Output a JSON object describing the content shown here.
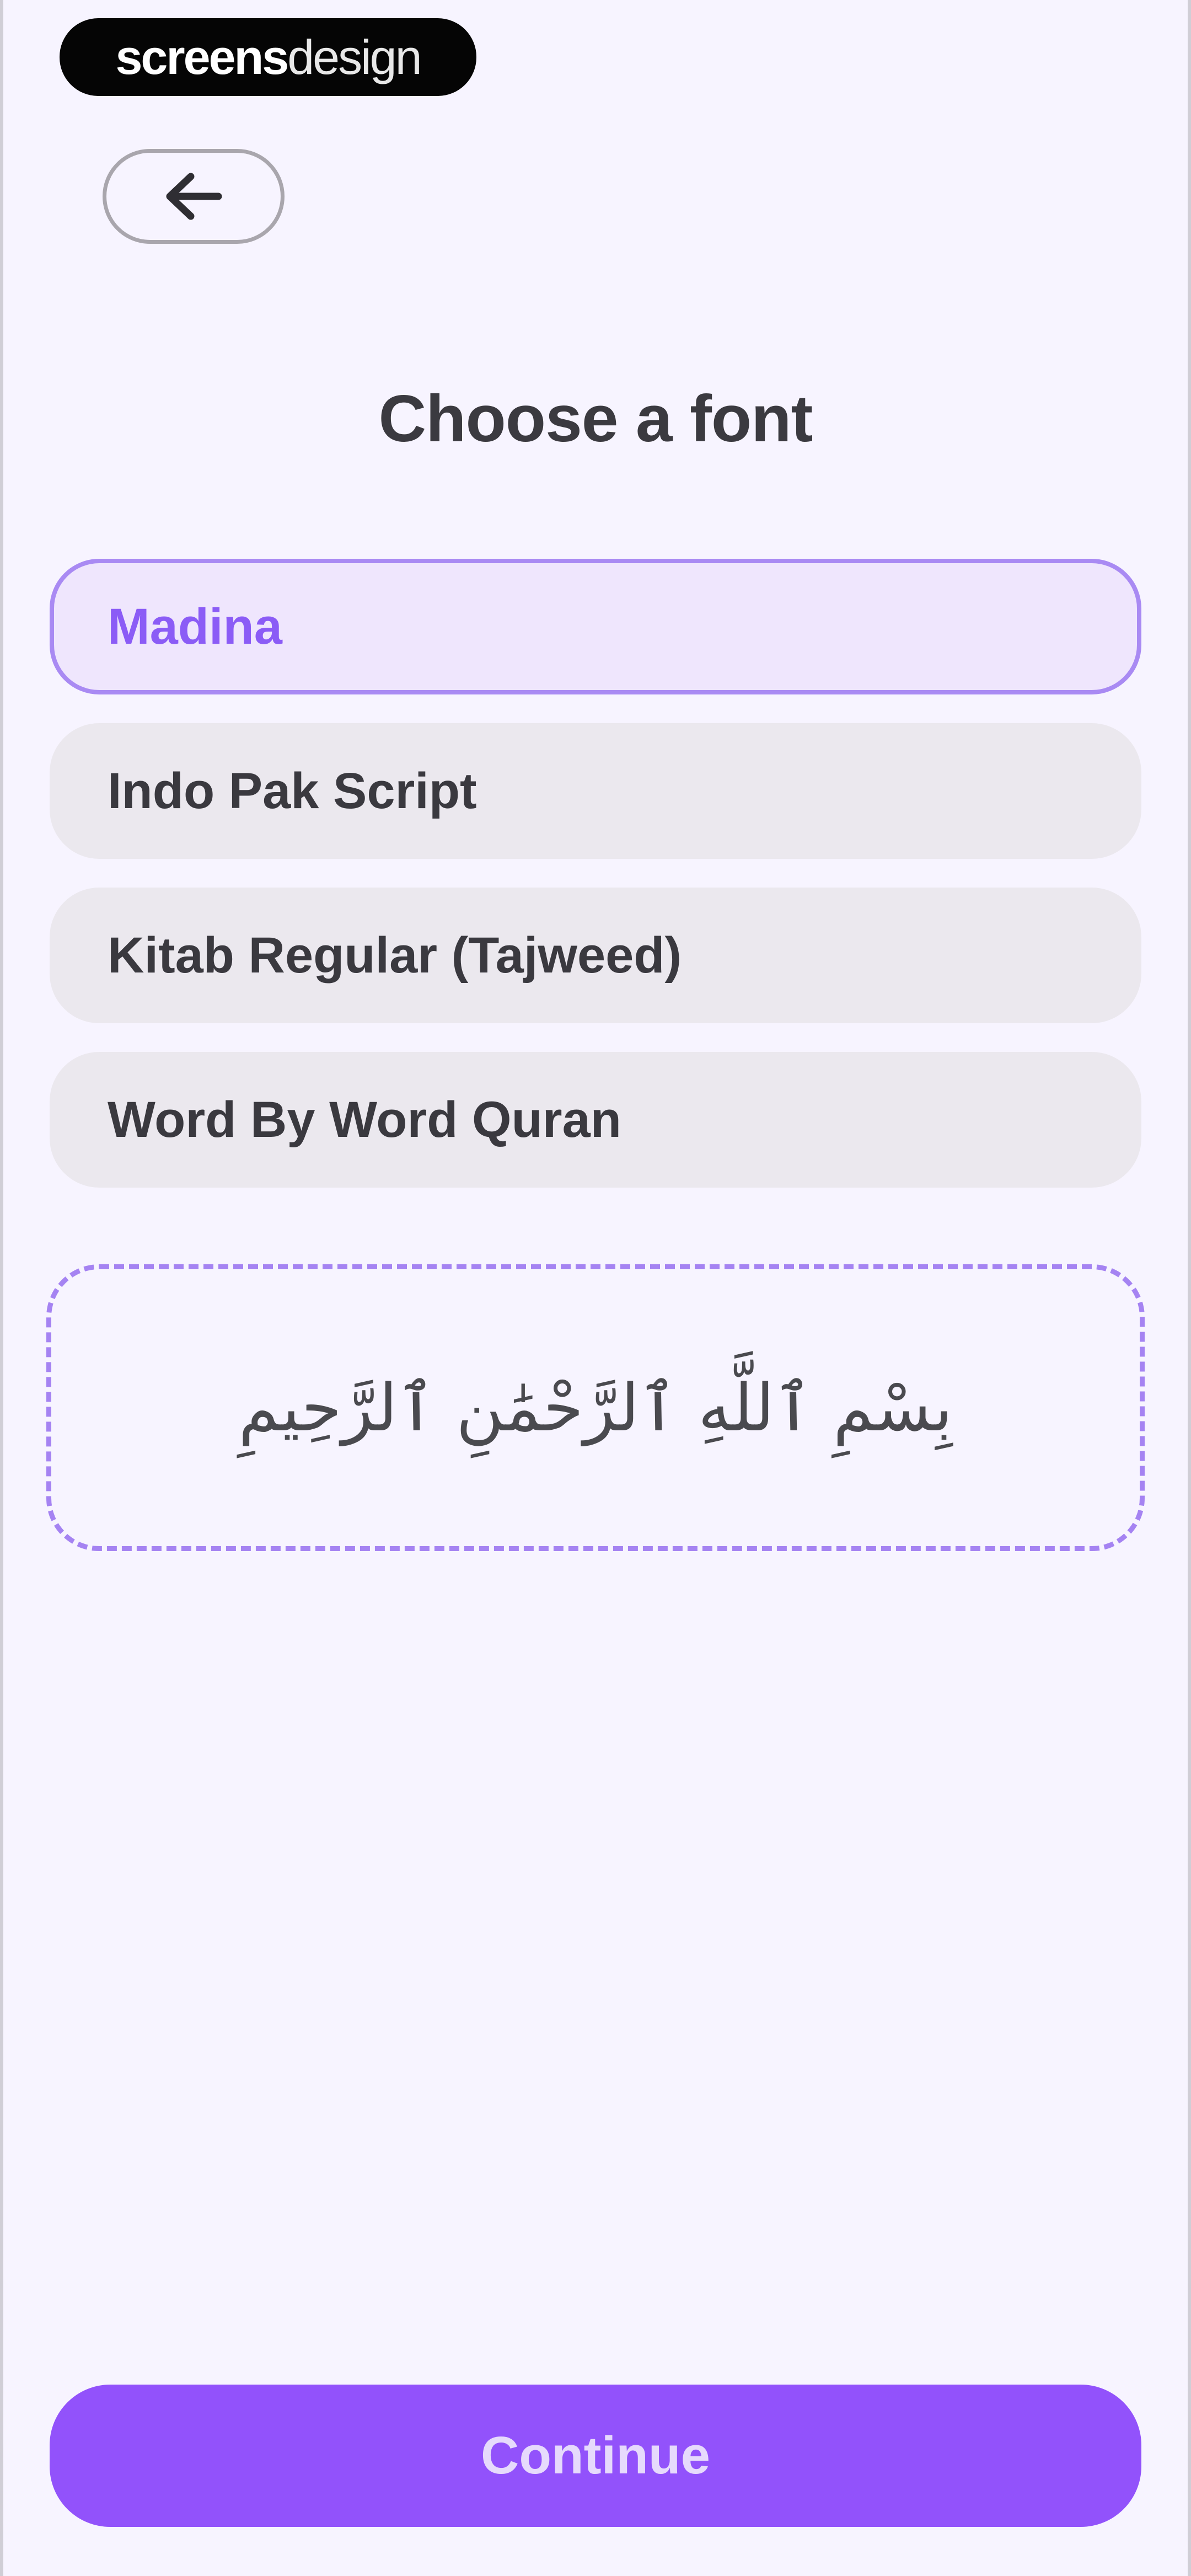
{
  "watermark": {
    "bold_part": "screens",
    "light_part": "design"
  },
  "header": {
    "back_icon": "arrow-left-icon",
    "title": "Choose a font"
  },
  "font_options": [
    {
      "label": "Madina",
      "selected": true
    },
    {
      "label": "Indo Pak Script",
      "selected": false
    },
    {
      "label": "Kitab Regular (Tajweed)",
      "selected": false
    },
    {
      "label": "Word By Word Quran",
      "selected": false
    }
  ],
  "preview": {
    "text": "بِسْمِ ٱللَّهِ ٱلرَّحْمَٰنِ ٱلرَّحِيمِ"
  },
  "continue_label": "Continue",
  "colors": {
    "accent": "#9252fb",
    "selected_text": "#8b5cf6",
    "selected_bg": "#efe6fd",
    "background": "#f7f4ff"
  }
}
